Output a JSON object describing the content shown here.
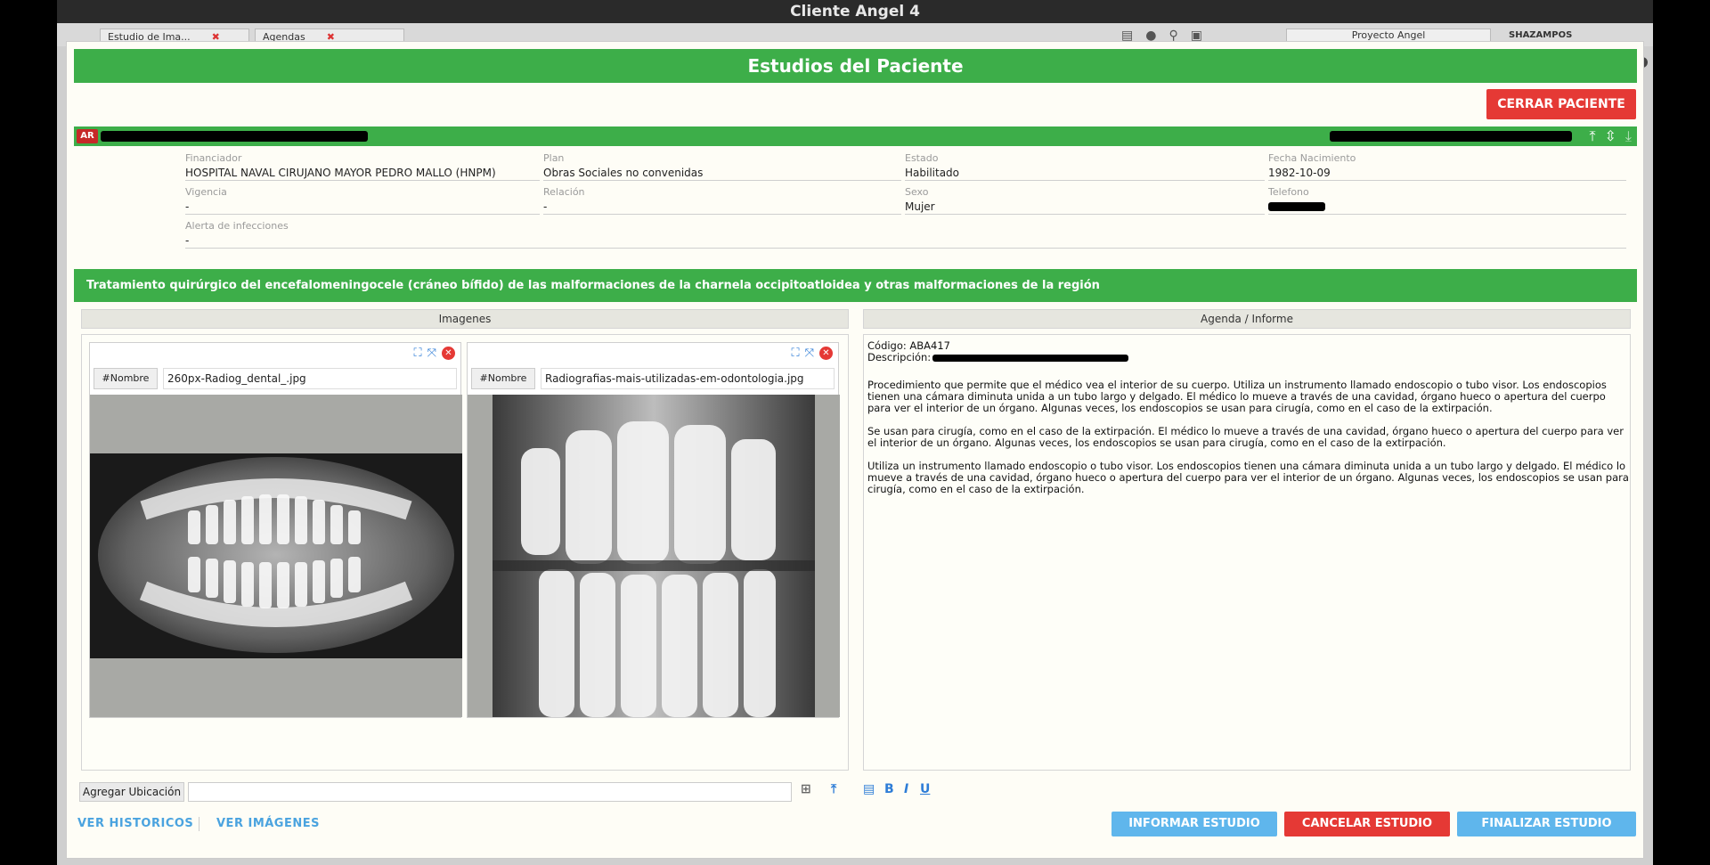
{
  "window": {
    "title": "Cliente Angel 4"
  },
  "background": {
    "tabs": [
      {
        "label": "Estudio de Ima..."
      },
      {
        "label": "Agendas"
      }
    ],
    "project": "Proyecto Angel",
    "user": "SHAZAMPOS"
  },
  "modal": {
    "title": "Estudios del Paciente",
    "close_patient_label": "CERRAR PACIENTE",
    "patient": {
      "badge": "AR",
      "fields": {
        "financiador": {
          "label": "Financiador",
          "value": "HOSPITAL NAVAL CIRUJANO MAYOR PEDRO MALLO (HNPM)"
        },
        "plan": {
          "label": "Plan",
          "value": "Obras Sociales no convenidas"
        },
        "estado": {
          "label": "Estado",
          "value": "Habilitado"
        },
        "fecha": {
          "label": "Fecha Nacimiento",
          "value": "1982-10-09"
        },
        "vigencia": {
          "label": "Vigencia",
          "value": "-"
        },
        "relacion": {
          "label": "Relación",
          "value": "-"
        },
        "sexo": {
          "label": "Sexo",
          "value": "Mujer"
        },
        "telefono": {
          "label": "Telefono",
          "value": ""
        },
        "alerta": {
          "label": "Alerta de infecciones",
          "value": "-"
        }
      }
    },
    "procedure_title": "Tratamiento quirúrgico del encefalomeningocele (cráneo bífido) de las malformaciones de la charnela occipitoatloidea y otras malformaciones de la región",
    "images_header": "Imagenes",
    "report_header": "Agenda / Informe",
    "images": [
      {
        "name_tag": "#Nombre",
        "filename": "260px-Radiog_dental_.jpg"
      },
      {
        "name_tag": "#Nombre",
        "filename": "Radiografias-mais-utilizadas-em-odontologia.jpg"
      }
    ],
    "study": {
      "codigo_label": "Código: ABA417",
      "descripcion_label": "Descripción:"
    },
    "report_paragraphs": [
      "Procedimiento que permite que el médico vea el interior de su cuerpo. Utiliza un instrumento llamado endoscopio o tubo visor. Los endoscopios tienen una cámara diminuta unida a un tubo largo y delgado. El médico lo mueve a través de una cavidad, órgano hueco o apertura del cuerpo para ver el interior de un órgano. Algunas veces, los endoscopios se usan para cirugía, como en el caso de la extirpación.",
      "Se usan para cirugía, como en el caso de la extirpación. El médico lo mueve a través de una cavidad, órgano hueco o apertura del cuerpo para ver el interior de un órgano. Algunas veces, los endoscopios se usan para cirugía, como en el caso de la extirpación.",
      "Utiliza un instrumento llamado endoscopio o tubo visor. Los endoscopios tienen una cámara diminuta unida a un tubo largo y delgado. El médico lo mueve a través de una cavidad, órgano hueco o apertura del cuerpo para ver el interior de un órgano. Algunas veces, los endoscopios se usan para cirugía, como en el caso de la extirpación."
    ],
    "location": {
      "button_label": "Agregar Ubicación",
      "value": ""
    },
    "footer": {
      "link_historicos": "VER HISTORICOS",
      "link_imagenes": "VER IMÁGENES",
      "btn_informar": "INFORMAR ESTUDIO",
      "btn_cancelar": "CANCELAR ESTUDIO",
      "btn_finalizar": "FINALIZAR ESTUDIO"
    }
  }
}
